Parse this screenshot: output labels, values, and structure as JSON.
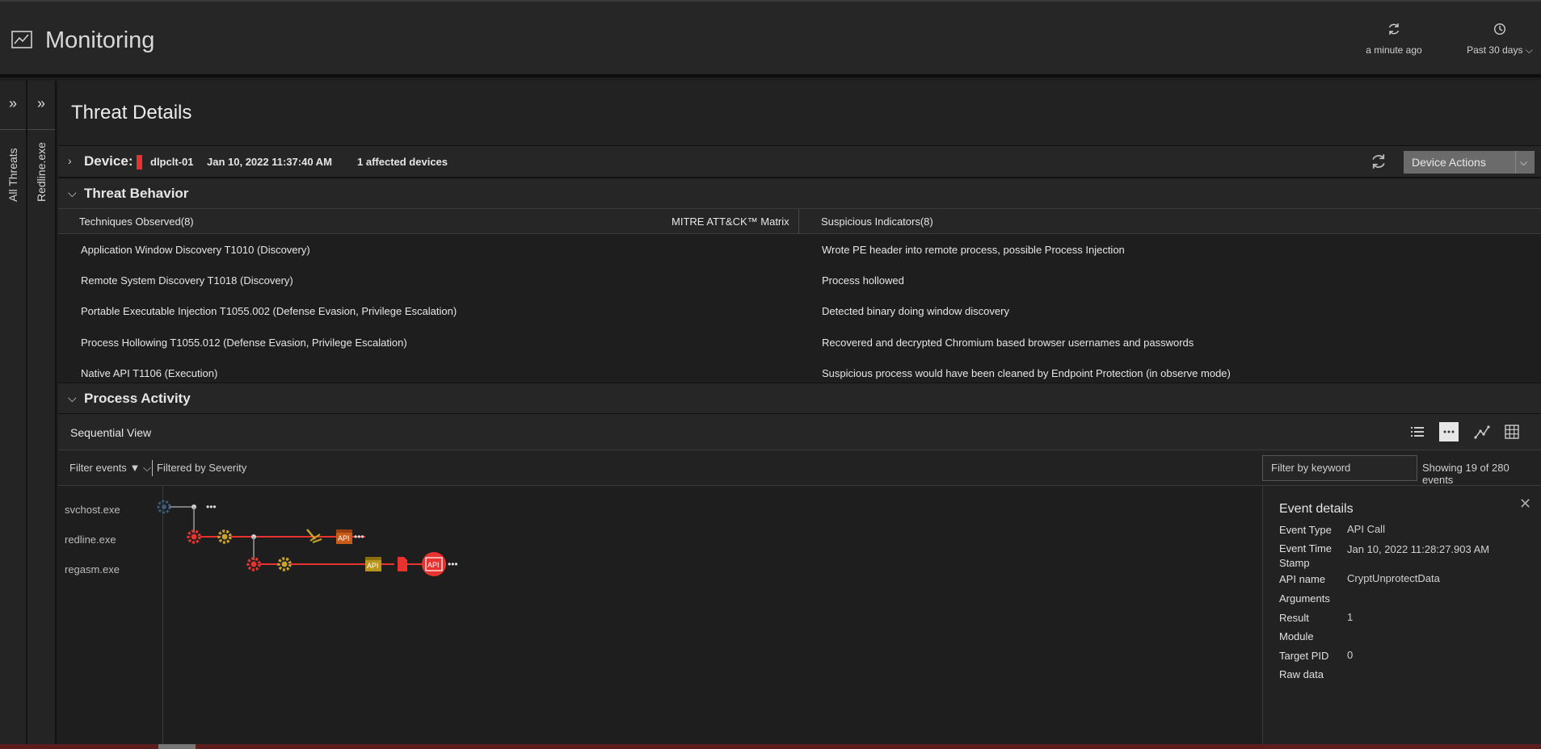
{
  "header": {
    "title": "Monitoring",
    "refresh_label": "a minute ago",
    "range_label": "Past 30 days"
  },
  "rails": {
    "all_threats": "All Threats",
    "redline": "Redline.exe"
  },
  "page": {
    "title": "Threat Details"
  },
  "device": {
    "label": "Device:",
    "name": "dlpclt-01",
    "date": "Jan 10, 2022 11:37:40 AM",
    "affected": "1 affected devices",
    "status_color": "#e8322f",
    "actions_label": "Device Actions"
  },
  "threat_behavior": {
    "title": "Threat Behavior",
    "techniques_header": "Techniques Observed(8)",
    "matrix_label": "MITRE ATT&CK™ Matrix",
    "indicators_header": "Suspicious Indicators(8)",
    "techniques": [
      "Application Window Discovery T1010 (Discovery)",
      "Remote System Discovery T1018 (Discovery)",
      "Portable Executable Injection T1055.002 (Defense Evasion, Privilege Escalation)",
      "Process Hollowing T1055.012 (Defense Evasion, Privilege Escalation)",
      "Native API T1106 (Execution)"
    ],
    "indicators": [
      "Wrote PE header into remote process, possible Process Injection",
      "Process hollowed",
      "Detected binary doing window discovery",
      "Recovered and decrypted Chromium based browser usernames and passwords",
      "Suspicious process would have been cleaned by Endpoint Protection (in observe mode)"
    ]
  },
  "process_activity": {
    "title": "Process Activity",
    "view_label": "Sequential View",
    "filter_events": "Filter events",
    "filtered_by": "Filtered by Severity",
    "keyword_placeholder": "Filter by keyword",
    "showing": "Showing 19 of 280 events",
    "lanes": [
      "svchost.exe",
      "redline.exe",
      "regasm.exe"
    ],
    "api_label": "API",
    "more_label": "•••"
  },
  "event_details": {
    "title": "Event details",
    "fields": [
      {
        "key": "Event Type",
        "value": "API Call"
      },
      {
        "key": "Event Time Stamp",
        "value": "Jan 10, 2022 11:28:27.903 AM"
      },
      {
        "key": "API name",
        "value": "CryptUnprotectData"
      },
      {
        "key": "Arguments",
        "value": ""
      },
      {
        "key": "Result",
        "value": "1"
      },
      {
        "key": "Module",
        "value": ""
      },
      {
        "key": "Target PID",
        "value": "0"
      },
      {
        "key": "Raw data",
        "value": ""
      }
    ]
  },
  "colors": {
    "alert_red": "#e8322f",
    "gear_gold": "#c9a227",
    "api_orange": "#c85a1a",
    "api_gold": "#b8961e",
    "svchost_blue": "#3a5a7a"
  }
}
